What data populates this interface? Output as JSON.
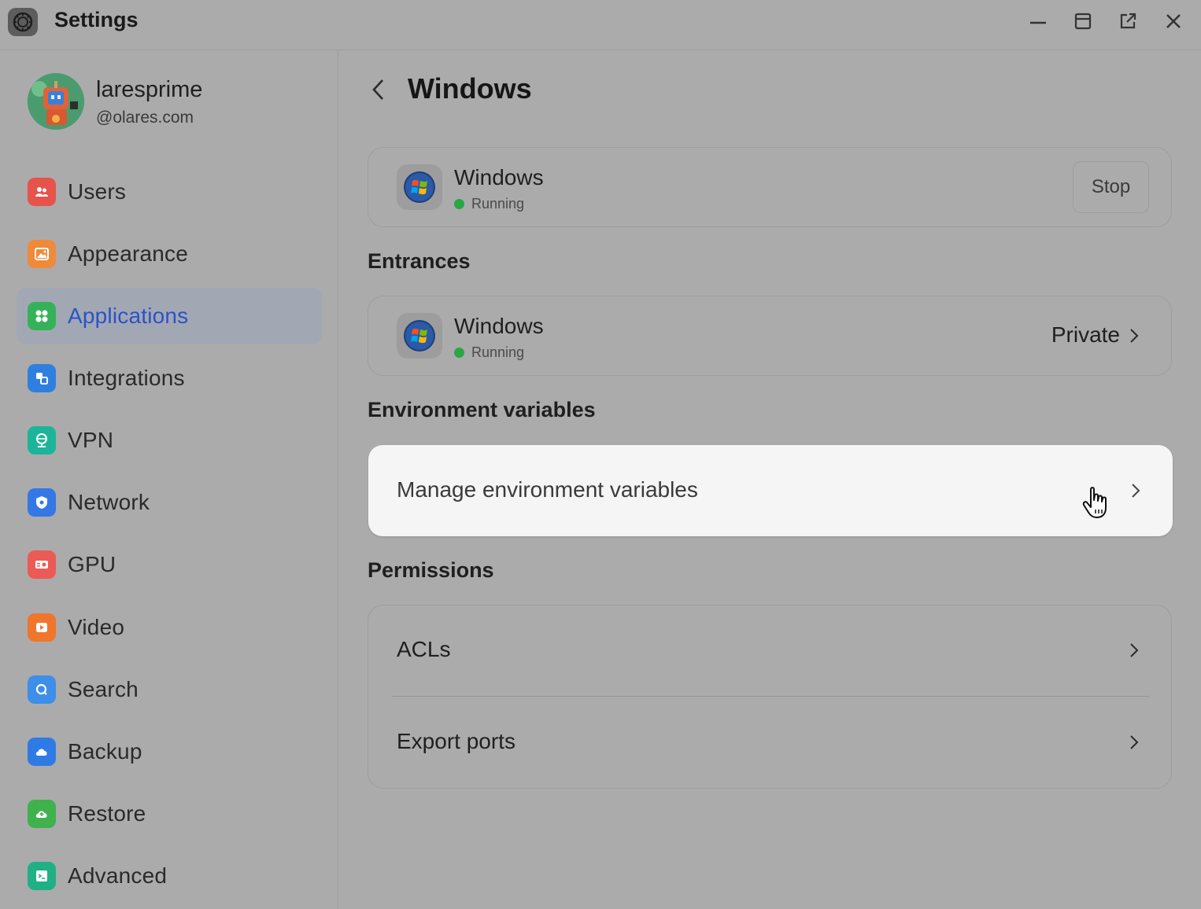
{
  "window": {
    "title": "Settings",
    "controls": [
      "minimize",
      "maximize",
      "open-external",
      "close"
    ]
  },
  "user": {
    "name": "laresprime",
    "domain": "@olares.com"
  },
  "sidebar": {
    "items": [
      {
        "label": "Users",
        "icon": "users-icon",
        "color": "#e5534b"
      },
      {
        "label": "Appearance",
        "icon": "image-icon",
        "color": "#ef8a3a"
      },
      {
        "label": "Applications",
        "icon": "apps-icon",
        "color": "#35b15a",
        "active": true
      },
      {
        "label": "Integrations",
        "icon": "integrations-icon",
        "color": "#2f7fe0"
      },
      {
        "label": "VPN",
        "icon": "vpn-icon",
        "color": "#1cb59a"
      },
      {
        "label": "Network",
        "icon": "network-icon",
        "color": "#3478e5"
      },
      {
        "label": "GPU",
        "icon": "gpu-icon",
        "color": "#ec5a55"
      },
      {
        "label": "Video",
        "icon": "video-icon",
        "color": "#f0752d"
      },
      {
        "label": "Search",
        "icon": "search-icon",
        "color": "#3d8fe8"
      },
      {
        "label": "Backup",
        "icon": "cloud-icon",
        "color": "#2f7be6"
      },
      {
        "label": "Restore",
        "icon": "restore-icon",
        "color": "#3fb24e"
      },
      {
        "label": "Advanced",
        "icon": "terminal-icon",
        "color": "#20b085"
      }
    ]
  },
  "main": {
    "back_icon": "chevron-left-icon",
    "title": "Windows",
    "app": {
      "name": "Windows",
      "status": "Running",
      "stop_label": "Stop"
    },
    "entrances": {
      "title": "Entrances",
      "item": {
        "name": "Windows",
        "status": "Running",
        "access": "Private"
      }
    },
    "env": {
      "title": "Environment variables",
      "manage_label": "Manage environment variables"
    },
    "permissions": {
      "title": "Permissions",
      "acls_label": "ACLs",
      "export_label": "Export ports"
    }
  },
  "colors": {
    "accent": "#2a52c9",
    "running": "#29a745"
  }
}
